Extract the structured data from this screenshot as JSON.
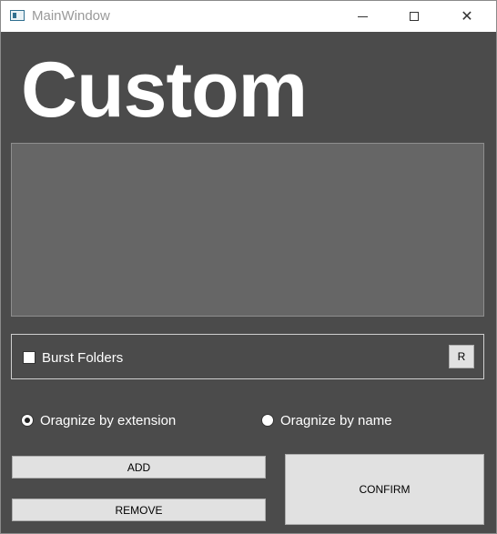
{
  "window": {
    "title": "MainWindow",
    "header": "Custom"
  },
  "titlebar_buttons": {
    "close_glyph": "✕"
  },
  "options": {
    "burst_label": "Burst Folders",
    "burst_checked": false,
    "r_label": "R"
  },
  "organize": {
    "by_extension_label": "Oragnize by extension",
    "by_extension_selected": true,
    "by_name_label": "Oragnize by name",
    "by_name_selected": false
  },
  "actions": {
    "add_label": "ADD",
    "remove_label": "REMOVE",
    "confirm_label": "CONFIRM"
  },
  "colors": {
    "background": "#4b4b4b",
    "list_background": "#666666",
    "button_face": "#e1e1e1"
  }
}
